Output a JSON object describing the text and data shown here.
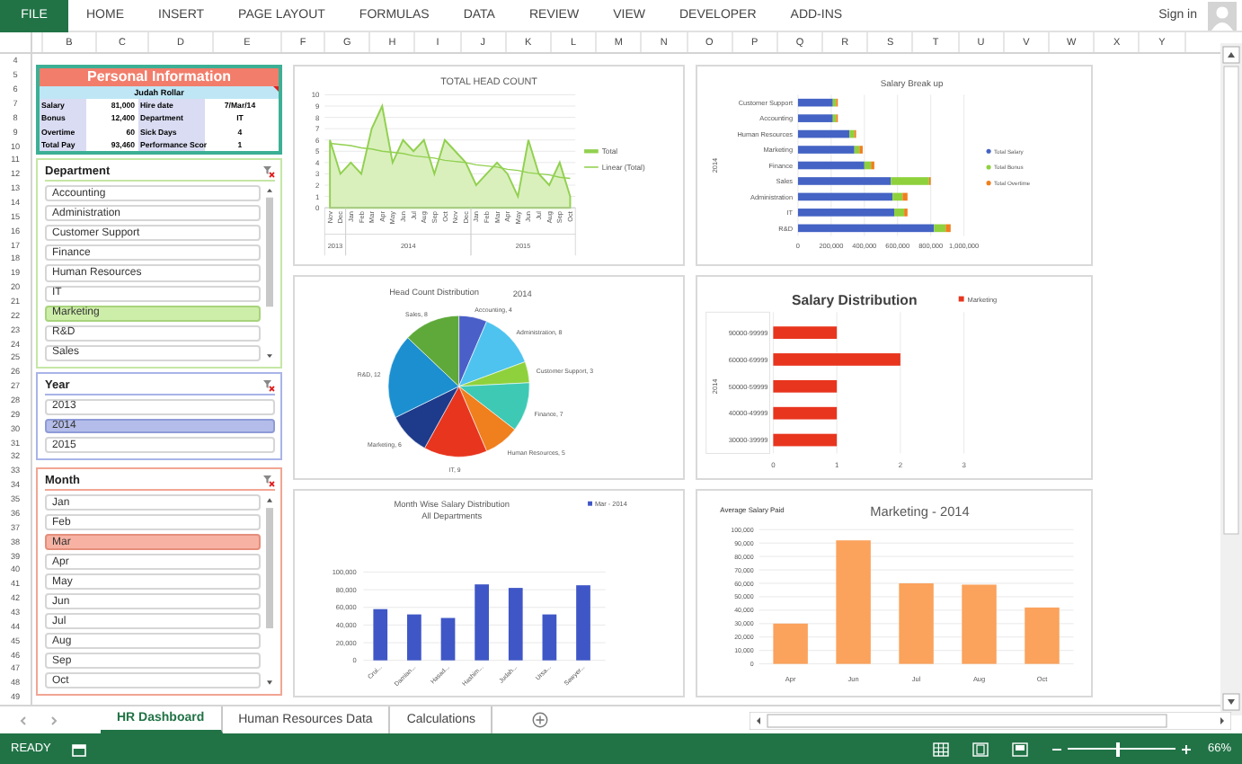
{
  "ribbon": {
    "file": "FILE",
    "tabs": [
      "HOME",
      "INSERT",
      "PAGE LAYOUT",
      "FORMULAS",
      "DATA",
      "REVIEW",
      "VIEW",
      "DEVELOPER",
      "ADD-INS"
    ],
    "sign_in": "Sign in"
  },
  "column_headers": [
    "B",
    "C",
    "D",
    "E",
    "F",
    "G",
    "H",
    "I",
    "J",
    "K",
    "L",
    "M",
    "N",
    "O",
    "P",
    "Q",
    "R",
    "S",
    "T",
    "U",
    "V",
    "W",
    "X",
    "Y"
  ],
  "row_numbers": [
    "4",
    "5",
    "6",
    "7",
    "8",
    "9",
    "10",
    "11",
    "12",
    "13",
    "14",
    "15",
    "16",
    "17",
    "18",
    "19",
    "20",
    "21",
    "22",
    "23",
    "24",
    "25",
    "26",
    "27",
    "28",
    "29",
    "30",
    "31",
    "32",
    "33",
    "34",
    "35",
    "36",
    "37",
    "38",
    "39",
    "40",
    "41",
    "42",
    "43",
    "44",
    "45",
    "46",
    "47",
    "48",
    "49"
  ],
  "personal_info": {
    "title": "Personal Information",
    "name": "Judah Rollar",
    "fields": [
      {
        "label": "Salary",
        "value": "81,000"
      },
      {
        "label": "Hire date",
        "value": "7/Mar/14"
      },
      {
        "label": "Bonus",
        "value": "12,400"
      },
      {
        "label": "Department",
        "value": "IT"
      },
      {
        "label": "Overtime",
        "value": "60"
      },
      {
        "label": "Sick Days",
        "value": "4"
      },
      {
        "label": "Total Pay",
        "value": "93,460"
      },
      {
        "label": "Performance Scor",
        "value": "1"
      }
    ]
  },
  "slicers": [
    {
      "kind": "department",
      "title": "Department",
      "scrollable": true,
      "items": [
        {
          "label": "Accounting",
          "selected": false
        },
        {
          "label": "Administration",
          "selected": false
        },
        {
          "label": "Customer Support",
          "selected": false
        },
        {
          "label": "Finance",
          "selected": false
        },
        {
          "label": "Human Resources",
          "selected": false
        },
        {
          "label": "IT",
          "selected": false
        },
        {
          "label": "Marketing",
          "selected": true
        },
        {
          "label": "R&D",
          "selected": false
        },
        {
          "label": "Sales",
          "selected": false
        }
      ]
    },
    {
      "kind": "year",
      "title": "Year",
      "scrollable": false,
      "items": [
        {
          "label": "2013",
          "selected": false
        },
        {
          "label": "2014",
          "selected": true
        },
        {
          "label": "2015",
          "selected": false
        }
      ]
    },
    {
      "kind": "month",
      "title": "Month",
      "scrollable": true,
      "items": [
        {
          "label": "Jan",
          "selected": false
        },
        {
          "label": "Feb",
          "selected": false
        },
        {
          "label": "Mar",
          "selected": true
        },
        {
          "label": "Apr",
          "selected": false
        },
        {
          "label": "May",
          "selected": false
        },
        {
          "label": "Jun",
          "selected": false
        },
        {
          "label": "Jul",
          "selected": false
        },
        {
          "label": "Aug",
          "selected": false
        },
        {
          "label": "Sep",
          "selected": false
        },
        {
          "label": "Oct",
          "selected": false
        }
      ]
    }
  ],
  "charts": [
    {
      "year_axis": [
        "2013",
        "2014",
        "2015"
      ],
      "chart_data": {
        "type": "area",
        "title": "TOTAL HEAD COUNT",
        "grid": true,
        "legend": "right",
        "categories": [
          "Nov",
          "Dec",
          "Jan",
          "Feb",
          "Mar",
          "Apr",
          "May",
          "Jun",
          "Jul",
          "Aug",
          "Sep",
          "Oct",
          "Nov",
          "Dec",
          "Jan",
          "Feb",
          "Mar",
          "Apr",
          "May",
          "Jun",
          "Jul",
          "Aug",
          "Sep",
          "Oct"
        ],
        "series": [
          {
            "name": "Total",
            "color": "#92d050",
            "values": [
              6,
              3,
              4,
              3,
              7,
              9,
              4,
              6,
              5,
              6,
              3,
              6,
              5,
              4,
              2,
              3,
              4,
              3,
              1,
              6,
              3,
              2,
              4,
              1
            ]
          },
          {
            "name": "Linear (Total)",
            "type": "line",
            "color": "#92d050",
            "values": [
              5.7,
              5.6,
              5.5,
              5.3,
              5.2,
              5,
              4.9,
              4.8,
              4.6,
              4.5,
              4.4,
              4.2,
              4.1,
              4,
              3.8,
              3.7,
              3.6,
              3.4,
              3.3,
              3.1,
              3,
              2.9,
              2.7,
              2.6
            ]
          }
        ],
        "ylim": [
          0,
          10
        ],
        "yticks": [
          0,
          1,
          2,
          3,
          4,
          5,
          6,
          7,
          8,
          9,
          10
        ]
      }
    },
    {
      "chart_data": {
        "type": "bar",
        "orientation": "horizontal",
        "stacked": true,
        "grid": true,
        "legend": "right",
        "title": "Salary Break up",
        "ylabel": "2014",
        "categories": [
          "Customer Support",
          "Accounting",
          "Human Resources",
          "Marketing",
          "Finance",
          "Sales",
          "Administration",
          "IT",
          "R&D"
        ],
        "series": [
          {
            "name": "Total Salary",
            "color": "#4463c4",
            "values": [
              210000,
              210000,
              310000,
              340000,
              400000,
              560000,
              570000,
              580000,
              820000
            ]
          },
          {
            "name": "Total Bonus",
            "color": "#8ed13c",
            "values": [
              20000,
              20000,
              30000,
              30000,
              40000,
              230000,
              60000,
              60000,
              70000
            ]
          },
          {
            "name": "Total Overtime",
            "color": "#f07f1e",
            "values": [
              10000,
              10000,
              10000,
              20000,
              20000,
              10000,
              30000,
              20000,
              30000
            ]
          }
        ],
        "xlim": [
          0,
          1000000
        ],
        "xticks": [
          0,
          {
            "value": 200000,
            "label": "200,000"
          },
          {
            "value": 400000,
            "label": "400,000"
          },
          {
            "value": 600000,
            "label": "600,000"
          },
          {
            "value": 800000,
            "label": "800,000"
          },
          {
            "value": 1000000,
            "label": "1,000,000"
          }
        ]
      }
    },
    {
      "chart_data": {
        "type": "pie",
        "title": "Head Count Distribution",
        "subtitle": "2014",
        "categories": [
          "Accounting, 4",
          "Administration, 8",
          "Customer Support, 3",
          "Finance, 7",
          "Human Resources, 5",
          "IT, 9",
          "Marketing, 6",
          "R&D, 12",
          "Sales, 8"
        ],
        "values": [
          4,
          8,
          3,
          7,
          5,
          9,
          6,
          12,
          8
        ]
      }
    },
    {
      "chart_data": {
        "type": "bar",
        "orientation": "horizontal",
        "stacked": false,
        "grid": true,
        "legend": "top right",
        "title": "Salary Distribution",
        "ylabel": "2014",
        "categories": [
          "90000-99999",
          "60000-69999",
          "50000-59999",
          "40000-49999",
          "30000-39999"
        ],
        "series": [
          {
            "name": "Marketing",
            "color": "#e8351e",
            "values": [
              1,
              2,
              1,
              1,
              1
            ]
          }
        ],
        "xlim": [
          0,
          3
        ],
        "xticks": [
          0,
          1,
          2,
          3
        ]
      }
    },
    {
      "kind": "column_3d",
      "chart_data": {
        "type": "bar",
        "orientation": "vertical",
        "grid": true,
        "legend": "top right",
        "title": "Month Wise Salary Distribution",
        "subtitle": "All Departments",
        "categories": [
          "Crui...",
          "Damian...",
          "Hasad...",
          "Hashim...",
          "Judah...",
          "Ursa...",
          "Sawyer..."
        ],
        "series": [
          {
            "name": "Mar - 2014",
            "color": "#3f57c6",
            "values": [
              58000,
              52000,
              48000,
              86000,
              82000,
              52000,
              85000
            ]
          }
        ],
        "ylim": [
          0,
          100000
        ],
        "yticks": [
          0,
          {
            "value": 20000,
            "label": "20,000"
          },
          {
            "value": 40000,
            "label": "40,000"
          },
          {
            "value": 60000,
            "label": "60,000"
          },
          {
            "value": 80000,
            "label": "80,000"
          },
          {
            "value": 100000,
            "label": "100,000"
          }
        ]
      }
    },
    {
      "kind": "column",
      "chart_data": {
        "type": "bar",
        "orientation": "vertical",
        "grid": true,
        "title": "Marketing - 2014",
        "ylabel": "Average Salary Paid",
        "categories": [
          "Apr",
          "Jun",
          "Jul",
          "Aug",
          "Oct"
        ],
        "series": [
          {
            "color": "#fba25c",
            "values": [
              30000,
              92000,
              60000,
              59000,
              42000
            ]
          }
        ],
        "ylim": [
          0,
          100000
        ],
        "yticks": [
          0,
          {
            "value": 10000,
            "label": "10,000"
          },
          {
            "value": 20000,
            "label": "20,000"
          },
          {
            "value": 30000,
            "label": "30,000"
          },
          {
            "value": 40000,
            "label": "40,000"
          },
          {
            "value": 50000,
            "label": "50,000"
          },
          {
            "value": 60000,
            "label": "60,000"
          },
          {
            "value": 70000,
            "label": "70,000"
          },
          {
            "value": 80000,
            "label": "80,000"
          },
          {
            "value": 90000,
            "label": "90,000"
          },
          {
            "value": 100000,
            "label": "100,000"
          }
        ]
      }
    }
  ],
  "sheet_tabs": [
    {
      "label": "HR Dashboard",
      "selected": true
    },
    {
      "label": "Human Resources Data",
      "selected": false
    },
    {
      "label": "Calculations",
      "selected": false
    }
  ],
  "status_bar": {
    "mode": "READY",
    "zoom": {
      "level": 0.45,
      "reading": "66%"
    }
  }
}
